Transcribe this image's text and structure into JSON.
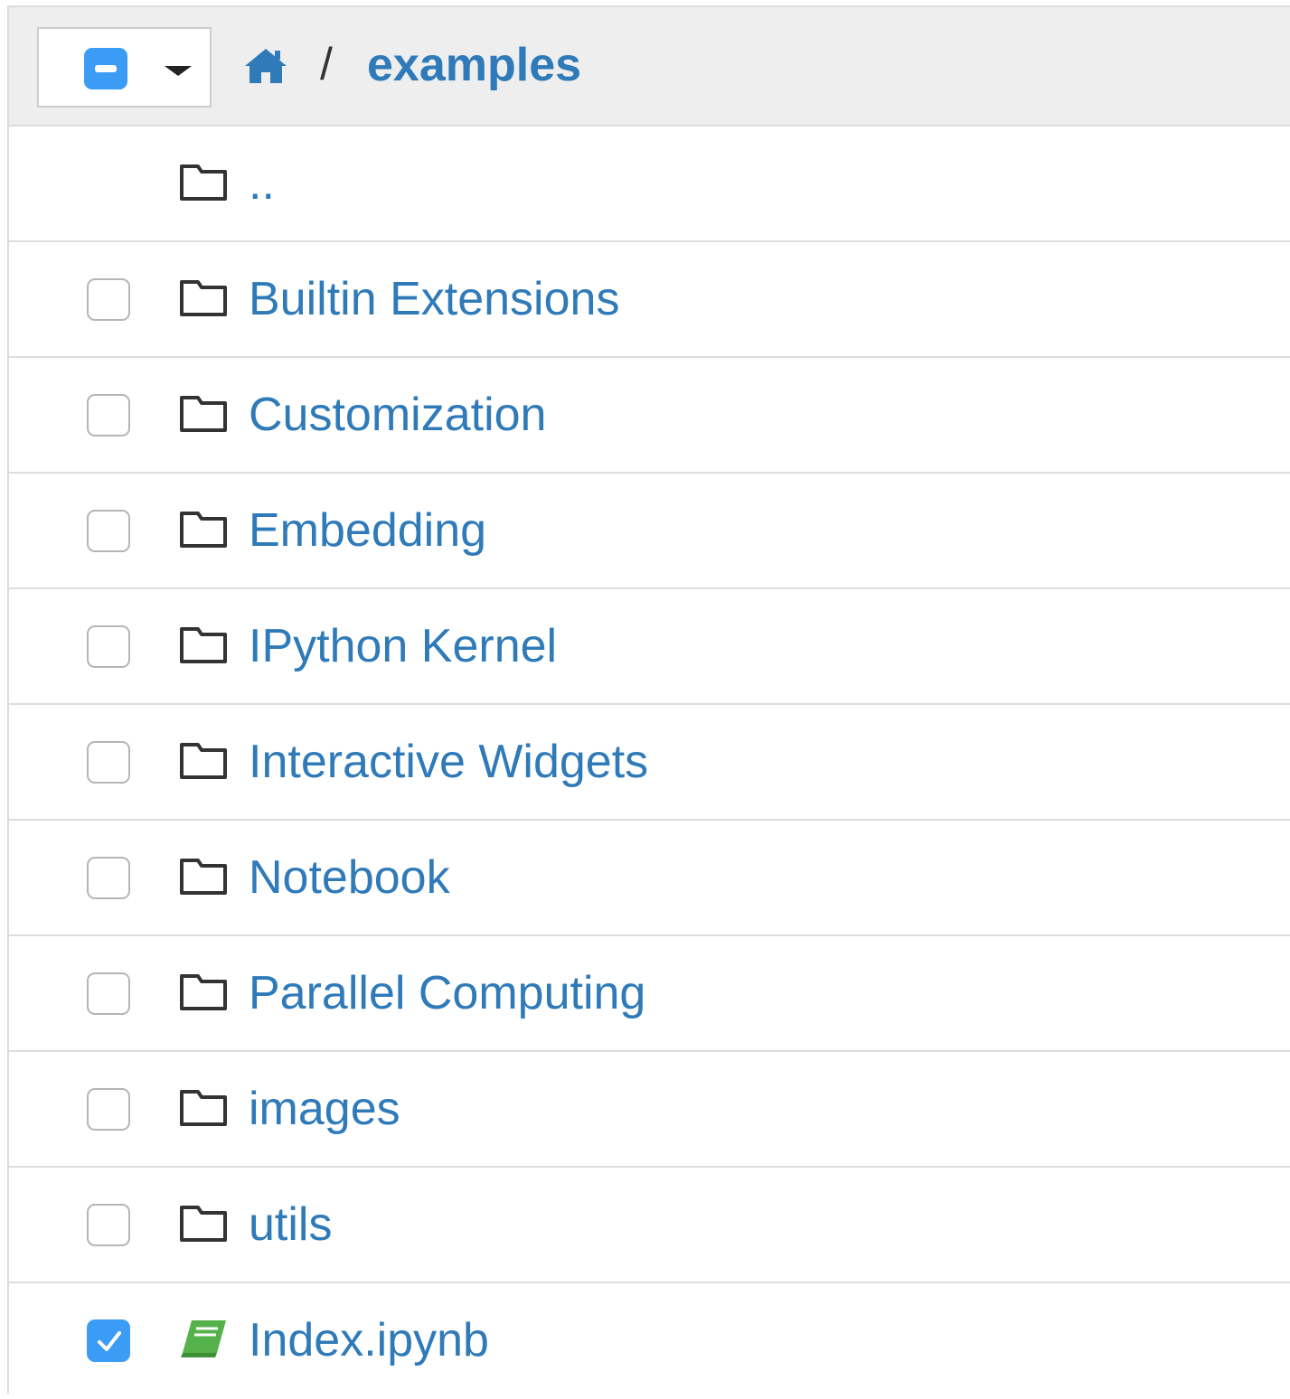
{
  "breadcrumb": {
    "separator": "/",
    "current": "examples"
  },
  "icons": {
    "select_all_state": "minus-icon",
    "dropdown": "caret-down-icon",
    "home": "home-icon",
    "folder": "folder-open-outline-icon",
    "notebook": "book-icon"
  },
  "colors": {
    "link": "#2f7ab8",
    "accent": "#3b9cf5",
    "header_bg": "#eeeeee",
    "notebook_icon": "#55b14a"
  },
  "rows": [
    {
      "name": "..",
      "type": "folder",
      "has_checkbox": false,
      "checked": false
    },
    {
      "name": "Builtin Extensions",
      "type": "folder",
      "has_checkbox": true,
      "checked": false
    },
    {
      "name": "Customization",
      "type": "folder",
      "has_checkbox": true,
      "checked": false
    },
    {
      "name": "Embedding",
      "type": "folder",
      "has_checkbox": true,
      "checked": false
    },
    {
      "name": "IPython Kernel",
      "type": "folder",
      "has_checkbox": true,
      "checked": false
    },
    {
      "name": "Interactive Widgets",
      "type": "folder",
      "has_checkbox": true,
      "checked": false
    },
    {
      "name": "Notebook",
      "type": "folder",
      "has_checkbox": true,
      "checked": false
    },
    {
      "name": "Parallel Computing",
      "type": "folder",
      "has_checkbox": true,
      "checked": false
    },
    {
      "name": "images",
      "type": "folder",
      "has_checkbox": true,
      "checked": false
    },
    {
      "name": "utils",
      "type": "folder",
      "has_checkbox": true,
      "checked": false
    },
    {
      "name": "Index.ipynb",
      "type": "notebook",
      "has_checkbox": true,
      "checked": true
    }
  ]
}
